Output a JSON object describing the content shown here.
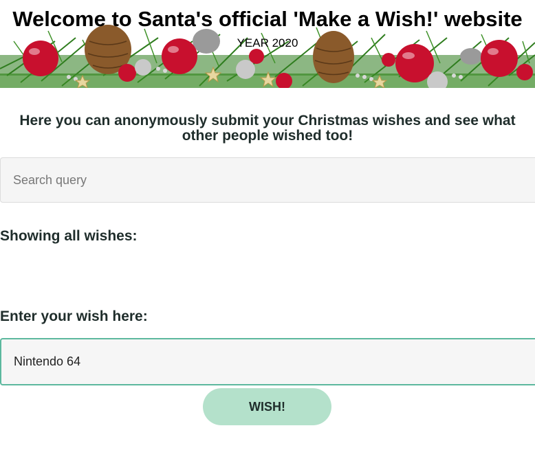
{
  "banner": {
    "title": "Welcome to Santa's official 'Make a Wish!' website",
    "subtitle": "YEAR 2020",
    "image": "christmas-garland-with-ornaments-and-pinecones",
    "colors": {
      "ornament_red": "#c8102e",
      "ornament_silver": "#c9c9c9",
      "pine_green": "#2f7d1e",
      "pinecone_brown": "#8a5a2b",
      "star_gold": "#e8d7a0"
    }
  },
  "intro_text": "Here you can anonymously submit your Christmas wishes and see what other people wished too!",
  "search": {
    "placeholder": "Search query",
    "value": ""
  },
  "wishes": {
    "heading": "Showing all wishes:",
    "items": []
  },
  "wish_form": {
    "heading": "Enter your wish here:",
    "input_value": "Nintendo 64",
    "button_label": "WISH!"
  },
  "colors": {
    "text": "#1f2d2b",
    "accent": "#5cb89e",
    "button_bg": "#b4e1cb",
    "input_bg": "#f5f5f5"
  }
}
